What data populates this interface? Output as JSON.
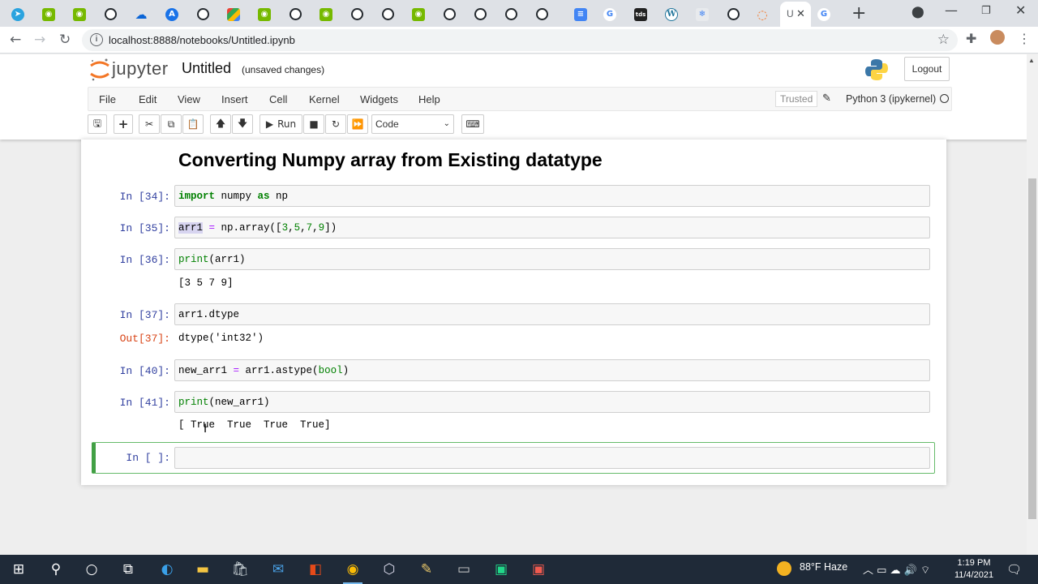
{
  "browser": {
    "url": "localhost:8888/notebooks/Untitled.ipynb",
    "active_tab_title": "U",
    "tab_icons": [
      "telegram-icon",
      "nvidia-icon",
      "nvidia-icon",
      "github-icon",
      "onedrive-icon",
      "azure-icon",
      "github-icon",
      "google-drive-icon",
      "nvidia-icon",
      "github-icon",
      "nvidia-icon",
      "github-icon",
      "github-icon",
      "nvidia-icon",
      "github-icon",
      "github-icon",
      "github-icon",
      "github-icon",
      "google-docs-icon",
      "google-icon",
      "tds-icon",
      "wordpress-icon",
      "mixed-icon",
      "github-icon",
      "jupyter-icon",
      "google-icon"
    ]
  },
  "jupyter": {
    "brand": "jupyter",
    "notebook_name": "Untitled",
    "save_status": "(unsaved changes)",
    "logout_label": "Logout",
    "menus": [
      "File",
      "Edit",
      "View",
      "Insert",
      "Cell",
      "Kernel",
      "Widgets",
      "Help"
    ],
    "trusted_label": "Trusted",
    "kernel_name": "Python 3 (ipykernel)",
    "toolbar": {
      "run_label": "Run",
      "cell_type": "Code"
    }
  },
  "notebook": {
    "heading": "Converting Numpy array from Existing datatype",
    "cells": [
      {
        "prompt": "In [34]:",
        "code": "import numpy as np"
      },
      {
        "prompt": "In [35]:",
        "code": "arr1 = np.array([3,5,7,9])"
      },
      {
        "prompt": "In [36]:",
        "code": "print(arr1)",
        "output": "[3 5 7 9]"
      },
      {
        "prompt": "In [37]:",
        "code": "arr1.dtype",
        "out_prompt": "Out[37]:",
        "output": "dtype('int32')"
      },
      {
        "prompt": "In [40]:",
        "code": "new_arr1 = arr1.astype(bool)"
      },
      {
        "prompt": "In [41]:",
        "code": "print(new_arr1)",
        "output": "[ True  True  True  True]"
      },
      {
        "prompt": "In [ ]:",
        "code": ""
      }
    ]
  },
  "taskbar": {
    "weather": "88°F  Haze",
    "time": "1:19 PM",
    "date": "11/4/2021"
  },
  "colors": {
    "prompt_in": "#303f9f",
    "prompt_out": "#d84315",
    "keyword": "#008000",
    "selected_cell_border": "#42a045",
    "taskbar_bg": "#1f2a38"
  }
}
